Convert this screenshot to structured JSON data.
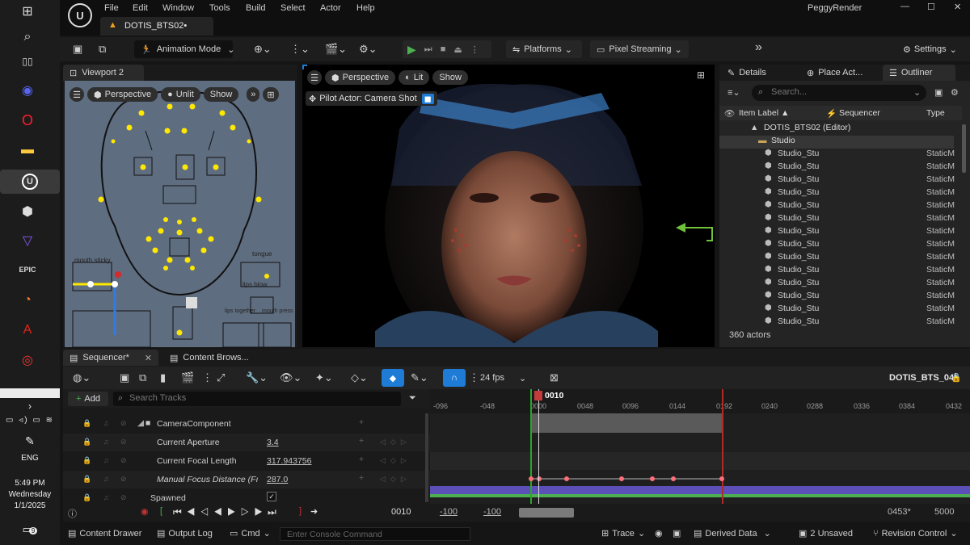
{
  "taskbar": {
    "clock_time": "5:49 PM",
    "clock_day": "Wednesday",
    "clock_date": "1/1/2025",
    "language": "ENG",
    "notification_count": "9",
    "icons": [
      "windows-icon",
      "search-icon",
      "task-view-icon",
      "discord-icon",
      "opera-icon",
      "terminal-icon",
      "file-explorer-icon",
      "unreal-engine-icon",
      "unity-icon",
      "proton-vpn-icon",
      "epic-games-icon",
      "blender-icon",
      "acrobat-icon",
      "onedrive-icon",
      "record-icon"
    ]
  },
  "menu": {
    "items": [
      "File",
      "Edit",
      "Window",
      "Tools",
      "Build",
      "Select",
      "Actor",
      "Help"
    ],
    "project_name": "PeggyRender",
    "window_controls": [
      "—",
      "☐",
      "✕"
    ]
  },
  "tab": {
    "title": "DOTIS_BTS02•"
  },
  "toolbar": {
    "mode": "Animation Mode",
    "platforms": "Platforms",
    "pixel_streaming": "Pixel Streaming",
    "settings": "Settings"
  },
  "viewport2": {
    "tab": "Viewport 2",
    "perspective": "Perspective",
    "unlit": "Unlit",
    "show": "Show",
    "labels": [
      "mouth sticky",
      "tongue",
      "lips blow",
      "lips together",
      "mouth press"
    ]
  },
  "main_viewport": {
    "perspective": "Perspective",
    "lit": "Lit",
    "show": "Show",
    "pilot": "Pilot Actor: Camera Shot"
  },
  "right_panel": {
    "tabs": [
      "Details",
      "Place Act...",
      "Outliner"
    ],
    "search_placeholder": "Search...",
    "columns": {
      "label": "Item Label ▲",
      "sequencer": "Sequencer",
      "type": "Type"
    },
    "root": "DOTIS_BTS02 (Editor)",
    "folder": "Studio",
    "rows": [
      {
        "name": "Studio_Stu",
        "type": "StaticM"
      },
      {
        "name": "Studio_Stu",
        "type": "StaticM"
      },
      {
        "name": "Studio_Stu",
        "type": "StaticM"
      },
      {
        "name": "Studio_Stu",
        "type": "StaticM"
      },
      {
        "name": "Studio_Stu",
        "type": "StaticM"
      },
      {
        "name": "Studio_Stu",
        "type": "StaticM"
      },
      {
        "name": "Studio_Stu",
        "type": "StaticM"
      },
      {
        "name": "Studio_Stu",
        "type": "StaticM"
      },
      {
        "name": "Studio_Stu",
        "type": "StaticM"
      },
      {
        "name": "Studio_Stu",
        "type": "StaticM"
      },
      {
        "name": "Studio_Stu",
        "type": "StaticM"
      },
      {
        "name": "Studio_Stu",
        "type": "StaticM"
      },
      {
        "name": "Studio_Stu",
        "type": "StaticM"
      },
      {
        "name": "Studio_Stu",
        "type": "StaticM"
      }
    ],
    "footer": "360 actors"
  },
  "sequencer": {
    "tabs": [
      "Sequencer*",
      "Content Brows..."
    ],
    "fps": "24 fps",
    "sequence_name": "DOTIS_BTS_04*",
    "add": "Add",
    "search_placeholder": "Search Tracks",
    "current_frame_label": "0010",
    "ticks": [
      "-096",
      "-048",
      "0000",
      "0048",
      "0096",
      "0144",
      "0192",
      "0240",
      "0288",
      "0336",
      "0384",
      "0432"
    ],
    "tracks": [
      {
        "label": "CameraComponent",
        "value": ""
      },
      {
        "label": "Current Aperture",
        "value": "3.4"
      },
      {
        "label": "Current Focal Length",
        "value": "317.943756"
      },
      {
        "label": "Manual Focus Distance (Fı",
        "value": "287.0"
      },
      {
        "label": "Spawned",
        "value": ""
      }
    ],
    "transport": {
      "frame": "0010",
      "start_a": "-100",
      "start_b": "-100",
      "end_a": "0453*",
      "end_b": "5000"
    }
  },
  "statusbar": {
    "content_drawer": "Content Drawer",
    "output_log": "Output Log",
    "cmd": "Cmd",
    "console_placeholder": "Enter Console Command",
    "trace": "Trace",
    "derived_data": "Derived Data",
    "unsaved": "2 Unsaved",
    "revision_control": "Revision Control"
  },
  "colors": {
    "accent_blue": "#1e7bd6",
    "play_green": "#4caf50",
    "key_pink": "#ff6f7a"
  }
}
